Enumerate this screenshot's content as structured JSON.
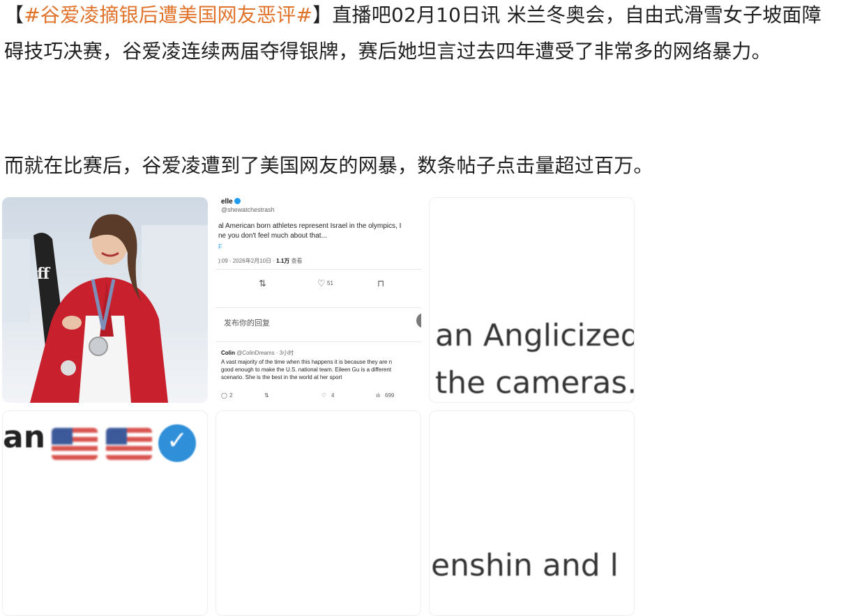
{
  "article": {
    "p1_open": "【",
    "p1_topic": "#谷爱凌摘银后遭美国网友恶评#",
    "p1_text": "】直播吧02月10日讯 米兰冬奥会，自由式滑雪女子坡面障碍技巧决赛，谷爱凌连续两届夺得银牌，赛后她坦言过去四年遭受了非常多的网络暴力。",
    "p2_text": "而就在比赛后，谷爱凌遭到了美国网友的网暴，数条帖子点击量超过百万。",
    "accent_color": "#e0722a"
  },
  "images": {
    "tweet": {
      "name": "elle",
      "handle": "@shewatchestrash",
      "body_line1": "al American born athletes represent Israel in the olympics, I",
      "body_line2": "ne you don't feel much about that...",
      "link": "F",
      "meta_time": "):09 · 2026年2月10日 · ",
      "meta_views": "1.1万",
      "meta_views_label": " 查看",
      "actions": {
        "retweet": "⇅",
        "like": "♡",
        "like_count": "51",
        "bookmark": "⊓"
      },
      "reply_placeholder": "发布你的回复",
      "comment": {
        "name": "Colin",
        "handle_time": " @ColinDreams · 3小时",
        "line1": "A vast majority of the time when this happens it is because they are n",
        "line2": "good enough to make the U.S. national team. Eileen Gu is a different",
        "line3": "scenario. She is the best in the world at her sport",
        "reply_count": "2",
        "like_count": "4",
        "views": "699"
      }
    },
    "zoom_anglicized": {
      "line1": "an Anglicized v",
      "line2": "the cameras. S"
    },
    "zoom_flags": {
      "text": "an"
    },
    "zoom_enship": {
      "text": "enshin and l"
    },
    "ski_brand": "ff"
  }
}
